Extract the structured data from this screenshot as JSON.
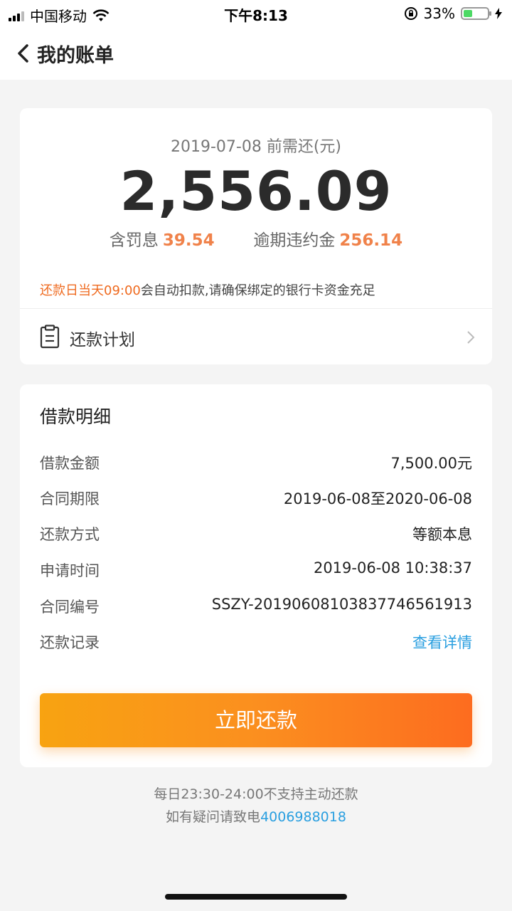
{
  "status_bar": {
    "carrier": "中国移动",
    "time": "下午8:13",
    "battery_percent": "33%",
    "battery_level": 0.33
  },
  "nav": {
    "title": "我的账单"
  },
  "summary": {
    "due_label": "2019-07-08 前需还(元)",
    "amount": "2,556.09",
    "penalty_label": "含罚息",
    "penalty_value": "39.54",
    "overdue_label": "逾期违约金",
    "overdue_value": "256.14",
    "notice_highlight": "还款日当天09:00",
    "notice_text": "会自动扣款,请确保绑定的银行卡资金充足",
    "plan_label": "还款计划"
  },
  "detail": {
    "heading": "借款明细",
    "rows": [
      {
        "key": "借款金额",
        "value": "7,500.00元"
      },
      {
        "key": "合同期限",
        "value": "2019-06-08至2020-06-08"
      },
      {
        "key": "还款方式",
        "value": "等额本息"
      },
      {
        "key": "申请时间",
        "value": "2019-06-08 10:38:37"
      },
      {
        "key": "合同编号",
        "value": "SSZY-20190608103837746561913"
      },
      {
        "key": "还款记录",
        "value": "查看详情"
      }
    ],
    "pay_button": "立即还款"
  },
  "footer": {
    "line1": "每日23:30-24:00不支持主动还款",
    "line2_prefix": "如有疑问请致电",
    "phone": "4006988018"
  },
  "colors": {
    "accent_orange": "#f0824a",
    "link_blue": "#2a9fe0",
    "button_gradient_start": "#f8a311",
    "button_gradient_end": "#fd6c1f"
  }
}
